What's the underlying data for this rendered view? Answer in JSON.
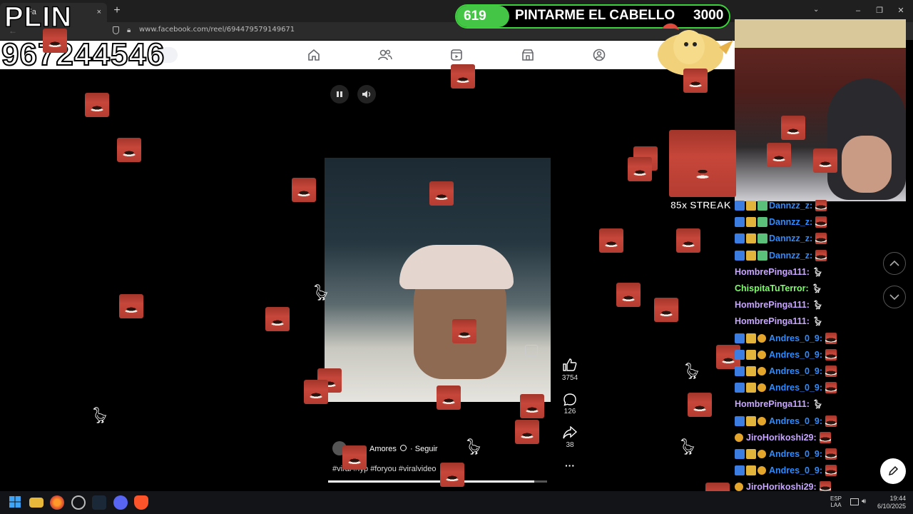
{
  "browser": {
    "tab_title": "Fa",
    "url": "www.facebook.com/reel/694479579149671",
    "new_tab_label": "+",
    "tab_close": "×",
    "window_controls": [
      "–",
      "❐",
      "✕"
    ]
  },
  "overlay": {
    "brand": "PLIN",
    "phone": "967244546",
    "goal": {
      "count": "619",
      "title": "PINTARME EL CABELLO",
      "target": "3000"
    },
    "streak": "85x STREAK"
  },
  "reel": {
    "author": "Amores",
    "follow_label": "Seguir",
    "separator": "·",
    "hashtags": "#viral #fyp #foryou #viralvideo",
    "likes": "3754",
    "comments": "126",
    "shares": "38",
    "more": "···",
    "progress": 0.94
  },
  "chat": [
    {
      "user": "Dannzz_z:",
      "badges": [
        "blue",
        "gold",
        "green"
      ],
      "color": "#2e8bff",
      "content": "emote"
    },
    {
      "user": "Dannzz_z:",
      "badges": [
        "blue",
        "gold",
        "green"
      ],
      "color": "#2e8bff",
      "content": "emote"
    },
    {
      "user": "Dannzz_z:",
      "badges": [
        "blue",
        "gold",
        "green"
      ],
      "color": "#2e8bff",
      "content": "emote"
    },
    {
      "user": "Dannzz_z:",
      "badges": [
        "blue",
        "gold",
        "green"
      ],
      "color": "#2e8bff",
      "content": "emote"
    },
    {
      "user": "HombrePinga111:",
      "badges": [],
      "color": "#c8a6ff",
      "content": "goose"
    },
    {
      "user": "ChispitaTuTerror:",
      "badges": [],
      "color": "#7cff6a",
      "content": "goose"
    },
    {
      "user": "HombrePinga111:",
      "badges": [],
      "color": "#c8a6ff",
      "content": "goose"
    },
    {
      "user": "HombrePinga111:",
      "badges": [],
      "color": "#c8a6ff",
      "content": "goose"
    },
    {
      "user": "Andres_0_9:",
      "badges": [
        "blue",
        "gold",
        "circle"
      ],
      "color": "#2e8bff",
      "content": "emote"
    },
    {
      "user": "Andres_0_9:",
      "badges": [
        "blue",
        "gold",
        "circle"
      ],
      "color": "#2e8bff",
      "content": "emote"
    },
    {
      "user": "Andres_0_9:",
      "badges": [
        "blue",
        "gold",
        "circle"
      ],
      "color": "#2e8bff",
      "content": "emote"
    },
    {
      "user": "Andres_0_9:",
      "badges": [
        "blue",
        "gold",
        "circle"
      ],
      "color": "#2e8bff",
      "content": "emote"
    },
    {
      "user": "HombrePinga111:",
      "badges": [],
      "color": "#c8a6ff",
      "content": "goose"
    },
    {
      "user": "Andres_0_9:",
      "badges": [
        "blue",
        "gold",
        "circle"
      ],
      "color": "#2e8bff",
      "content": "emote"
    },
    {
      "user": "JiroHorikoshi29:",
      "badges": [
        "circle"
      ],
      "color": "#c8a6ff",
      "content": "emote"
    },
    {
      "user": "Andres_0_9:",
      "badges": [
        "blue",
        "gold",
        "circle"
      ],
      "color": "#2e8bff",
      "content": "emote"
    },
    {
      "user": "Andres_0_9:",
      "badges": [
        "blue",
        "gold",
        "circle"
      ],
      "color": "#2e8bff",
      "content": "emote"
    },
    {
      "user": "JiroHorikoshi29:",
      "badges": [
        "circle"
      ],
      "color": "#c8a6ff",
      "content": "emote"
    },
    {
      "user": "JiroHorikoshi29:",
      "badges": [
        "circle"
      ],
      "color": "#c8a6ff",
      "content": "emote"
    }
  ],
  "taskbar": {
    "lang": "ESP",
    "lang2": "LAA",
    "time": "19:44",
    "date": "6/10/2025"
  },
  "colors": {
    "goal_green": "#45c545",
    "fb_icon": "#65676b",
    "chat_blue": "#2e8bff"
  }
}
